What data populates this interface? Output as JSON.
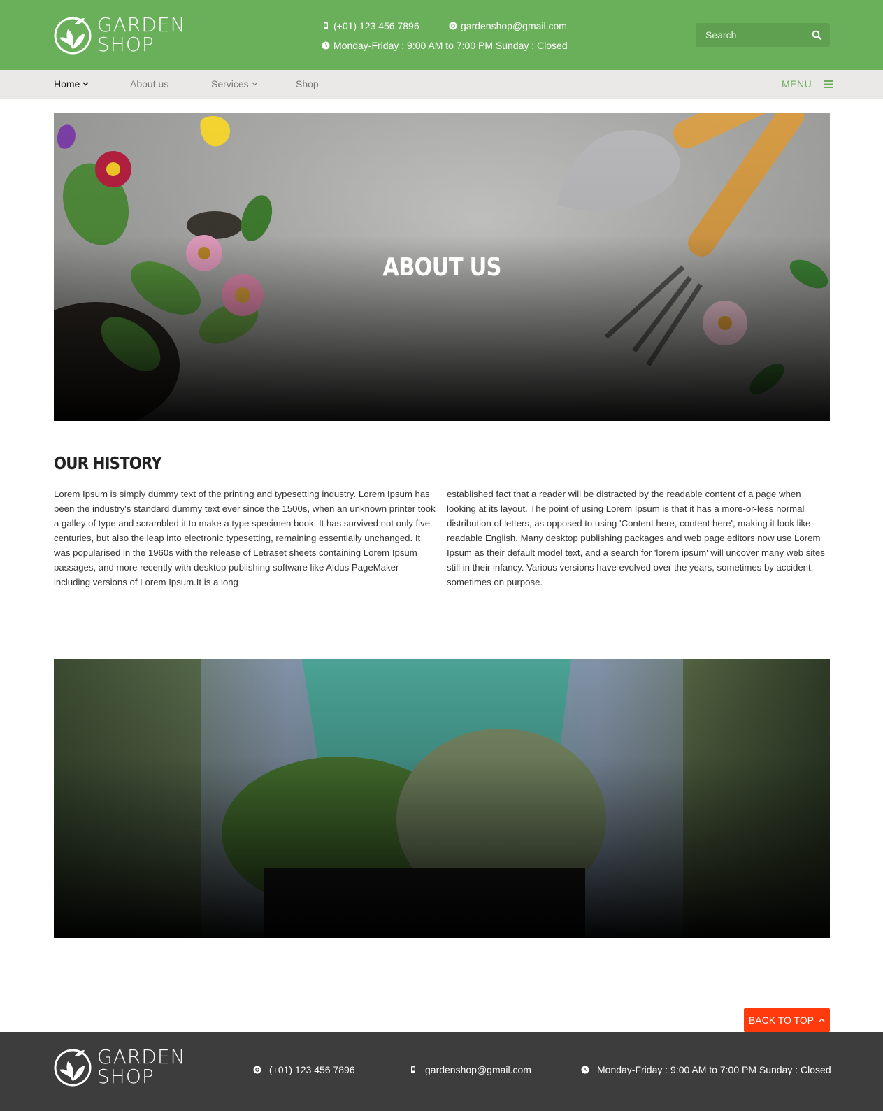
{
  "brand": {
    "line1": "GARDEN",
    "line2": "SHOP"
  },
  "header": {
    "phone": "(+01) 123 456 7896",
    "email": "gardenshop@gmail.com",
    "hours": "Monday-Friday : 9:00 AM to 7:00 PM Sunday : Closed",
    "search_placeholder": "Search"
  },
  "nav": {
    "items": [
      {
        "label": "Home",
        "active": true,
        "dropdown": true
      },
      {
        "label": "About us",
        "active": false,
        "dropdown": false
      },
      {
        "label": "Services",
        "active": false,
        "dropdown": true
      },
      {
        "label": "Shop",
        "active": false,
        "dropdown": false
      }
    ],
    "menu_label": "MENU"
  },
  "hero": {
    "title": "ABOUT US"
  },
  "history": {
    "title": "OUR HISTORY",
    "col1": "Lorem Ipsum is simply dummy text of the printing and typesetting industry. Lorem Ipsum has been the industry's standard dummy text ever since the 1500s, when an unknown printer took a galley of type and scrambled it to make a type specimen book. It has survived not only five centuries, but also the leap into electronic typesetting, remaining essentially unchanged. It was popularised in the 1960s with the release of Letraset sheets containing Lorem Ipsum passages, and more recently with desktop publishing software like Aldus PageMaker including versions of Lorem Ipsum.It is a long",
    "col2": "established fact that a reader will be distracted by the readable content of a page when looking at its layout. The point of using Lorem Ipsum is that it has a more-or-less normal distribution of letters, as opposed to using 'Content here, content here', making it look like readable English. Many desktop publishing packages and web page editors now use Lorem Ipsum as their default model text, and a search for 'lorem ipsum' will uncover many web sites still in their infancy. Various versions have evolved over the years, sometimes by accident, sometimes on purpose."
  },
  "back_to_top": "BACK TO TOP",
  "footer": {
    "phone": "(+01) 123 456 7896",
    "email": "gardenshop@gmail.com",
    "hours": "Monday-Friday : 9:00 AM to 7:00 PM Sunday : Closed"
  },
  "colors": {
    "header_green": "#6ab05a",
    "nav_bg": "#ebe9e8",
    "footer_bg": "#3d3d3d",
    "back_to_top": "#ff3b0e"
  },
  "icons": [
    "leaf-logo-icon",
    "phone-icon",
    "email-icon",
    "clock-icon",
    "search-icon",
    "chevron-down-icon",
    "hamburger-icon",
    "chevron-up-icon"
  ]
}
